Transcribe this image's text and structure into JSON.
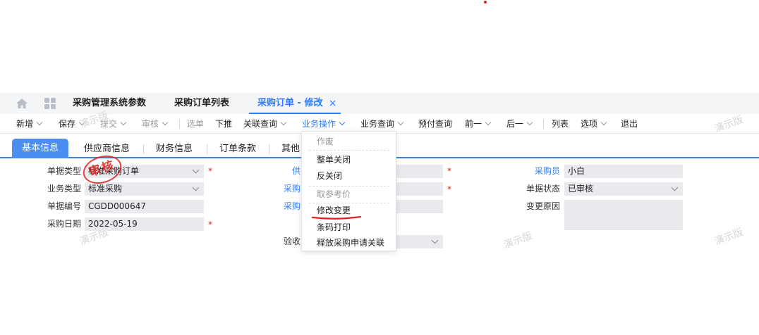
{
  "tabs": {
    "items": [
      "采购管理系统参数",
      "采购订单列表",
      "采购订单 - 修改"
    ],
    "close": "×"
  },
  "toolbar": {
    "new": "新增",
    "save": "保存",
    "submit": "提交",
    "audit": "审核",
    "select": "选单",
    "push": "下推",
    "related_query": "关联查询",
    "business_ops": "业务操作",
    "business_query": "业务查询",
    "prepay_query": "预付查询",
    "prev": "前一",
    "next": "后一",
    "list": "列表",
    "options": "选项",
    "exit": "退出"
  },
  "subtabs": [
    "基本信息",
    "供应商信息",
    "财务信息",
    "订单条款",
    "其他"
  ],
  "form": {
    "doc_type_label": "单据类型",
    "doc_type_value": "标准采购订单",
    "biz_type_label": "业务类型",
    "biz_type_value": "标准采购",
    "doc_no_label": "单据编号",
    "doc_no_value": "CGDD000647",
    "date_label": "采购日期",
    "date_value": "2022-05-19",
    "supplier_label": "供",
    "dept_label": "采购",
    "group_label": "采购",
    "acceptance_label": "验收",
    "buyer_label": "采购员",
    "buyer_value": "小白",
    "status_label": "单据状态",
    "status_value": "已审核",
    "change_reason_label": "变更原因",
    "required_mark": "*"
  },
  "stamp": "审核",
  "watermark": "演示版",
  "menu": {
    "group_cancel": "作废",
    "close_all": "整单关闭",
    "unclose": "反关闭",
    "group_ref": "取参考价",
    "modify_change": "修改变更",
    "barcode_print": "条码打印",
    "release_link": "释放采购申请关联"
  },
  "colors": {
    "accent": "#2f7cf5",
    "required": "#e02020",
    "field_bg": "#e8eaee"
  }
}
